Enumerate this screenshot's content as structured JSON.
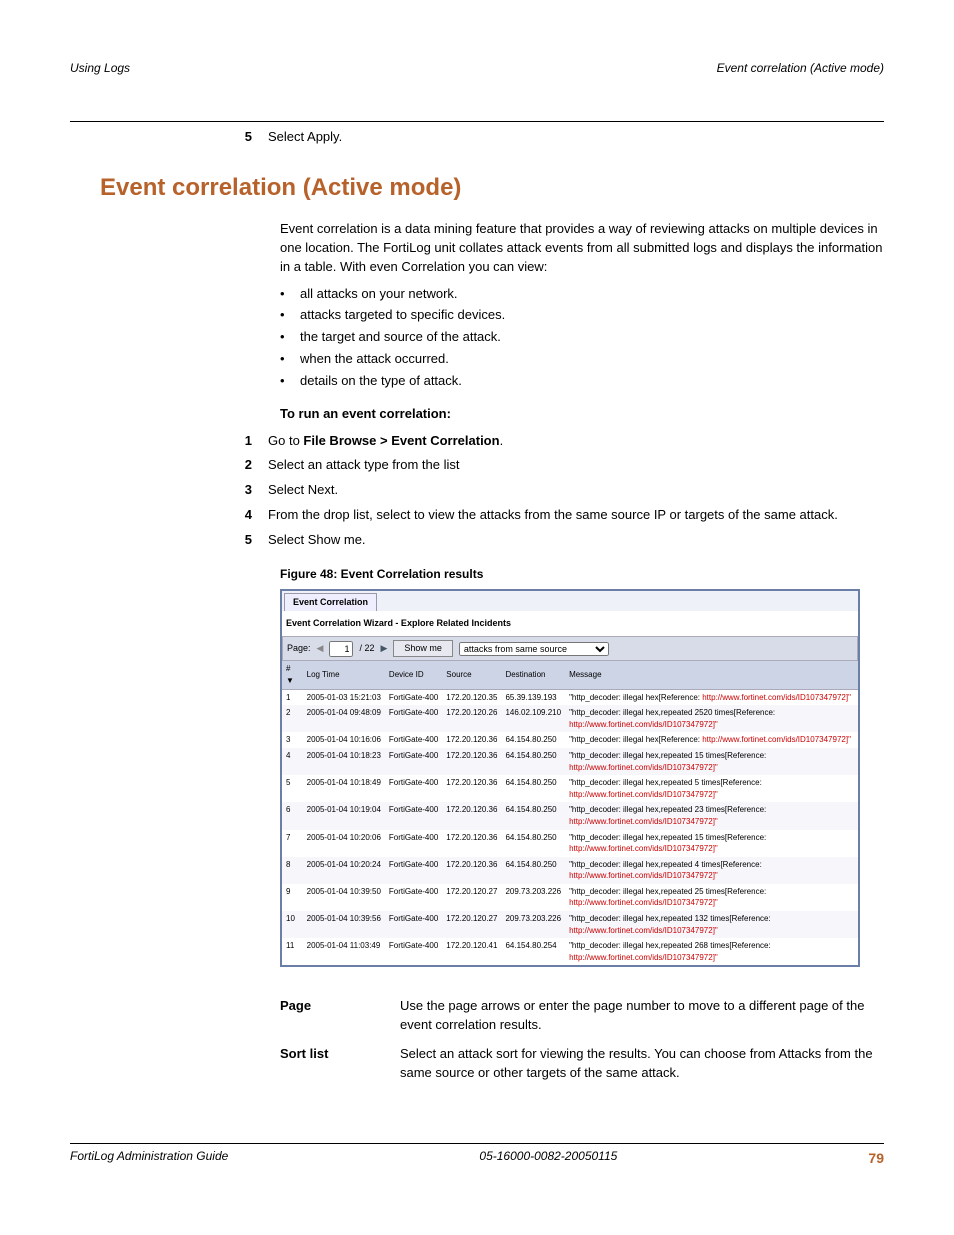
{
  "header": {
    "left": "Using Logs",
    "right": "Event correlation (Active mode)"
  },
  "footer": {
    "left": "FortiLog Administration Guide",
    "center": "05-16000-0082-20050115",
    "page": "79"
  },
  "step5_pre": {
    "num": "5",
    "text": "Select Apply."
  },
  "section_title": "Event correlation (Active mode)",
  "intro": "Event correlation is a data mining feature that provides a way of reviewing attacks on multiple devices in one location. The FortiLog unit collates attack events from all submitted logs and displays the information in a table. With even Correlation you can view:",
  "bullets": [
    "all attacks on your network.",
    "attacks targeted to specific devices.",
    "the target and source of the attack.",
    "when the attack occurred.",
    "details on the type of attack."
  ],
  "run_head": "To run an event correlation:",
  "steps": [
    {
      "num": "1",
      "pre": "Go to ",
      "bold": "File Browse > Event Correlation",
      "post": "."
    },
    {
      "num": "2",
      "text": "Select an attack type from the list"
    },
    {
      "num": "3",
      "text": "Select Next."
    },
    {
      "num": "4",
      "text": "From the drop list, select to view the attacks from the same source IP or targets of the same attack."
    },
    {
      "num": "5",
      "text": "Select Show me."
    }
  ],
  "fig_caption": "Figure 48: Event Correlation results",
  "fig": {
    "tab": "Event Correlation",
    "wizard": "Event Correlation Wizard - Explore Related Incidents",
    "page_label": "Page:",
    "page_val": "1",
    "page_total": "/ 22",
    "showme": "Show me",
    "dropdown": "attacks from same source",
    "cols": [
      "#",
      "Log Time",
      "Device ID",
      "Source",
      "Destination",
      "Message"
    ],
    "url": "http://www.fortinet.com/ids/ID107347972",
    "rows": [
      {
        "n": "1",
        "t": "2005-01-03 15:21:03",
        "d": "FortiGate-400",
        "s": "172.20.120.35",
        "dst": "65.39.139.193",
        "m": "\"http_decoder: illegal hex[Reference:"
      },
      {
        "n": "2",
        "t": "2005-01-04 09:48:09",
        "d": "FortiGate-400",
        "s": "172.20.120.26",
        "dst": "146.02.109.210",
        "m": "\"http_decoder: illegal hex,repeated 2520 times[Reference:"
      },
      {
        "n": "3",
        "t": "2005-01-04 10:16:06",
        "d": "FortiGate-400",
        "s": "172.20.120.36",
        "dst": "64.154.80.250",
        "m": "\"http_decoder: illegal hex[Reference:"
      },
      {
        "n": "4",
        "t": "2005-01-04 10:18:23",
        "d": "FortiGate-400",
        "s": "172.20.120.36",
        "dst": "64.154.80.250",
        "m": "\"http_decoder: illegal hex,repeated 15 times[Reference:"
      },
      {
        "n": "5",
        "t": "2005-01-04 10:18:49",
        "d": "FortiGate-400",
        "s": "172.20.120.36",
        "dst": "64.154.80.250",
        "m": "\"http_decoder: illegal hex,repeated 5 times[Reference:"
      },
      {
        "n": "6",
        "t": "2005-01-04 10:19:04",
        "d": "FortiGate-400",
        "s": "172.20.120.36",
        "dst": "64.154.80.250",
        "m": "\"http_decoder: illegal hex,repeated 23 times[Reference:"
      },
      {
        "n": "7",
        "t": "2005-01-04 10:20:06",
        "d": "FortiGate-400",
        "s": "172.20.120.36",
        "dst": "64.154.80.250",
        "m": "\"http_decoder: illegal hex,repeated 15 times[Reference:"
      },
      {
        "n": "8",
        "t": "2005-01-04 10:20:24",
        "d": "FortiGate-400",
        "s": "172.20.120.36",
        "dst": "64.154.80.250",
        "m": "\"http_decoder: illegal hex,repeated 4 times[Reference:"
      },
      {
        "n": "9",
        "t": "2005-01-04 10:39:50",
        "d": "FortiGate-400",
        "s": "172.20.120.27",
        "dst": "209.73.203.226",
        "m": "\"http_decoder: illegal hex,repeated 25 times[Reference:"
      },
      {
        "n": "10",
        "t": "2005-01-04 10:39:56",
        "d": "FortiGate-400",
        "s": "172.20.120.27",
        "dst": "209.73.203.226",
        "m": "\"http_decoder: illegal hex,repeated 132 times[Reference:"
      },
      {
        "n": "11",
        "t": "2005-01-04 11:03:49",
        "d": "FortiGate-400",
        "s": "172.20.120.41",
        "dst": "64.154.80.254",
        "m": "\"http_decoder: illegal hex,repeated 268 times[Reference:"
      }
    ]
  },
  "defs": [
    {
      "term": "Page",
      "desc": "Use the page arrows or enter the page number to move to a different page of the event correlation results."
    },
    {
      "term": "Sort list",
      "desc": "Select an attack sort for viewing the results. You can choose from Attacks from the same source or other targets of the same attack."
    }
  ]
}
